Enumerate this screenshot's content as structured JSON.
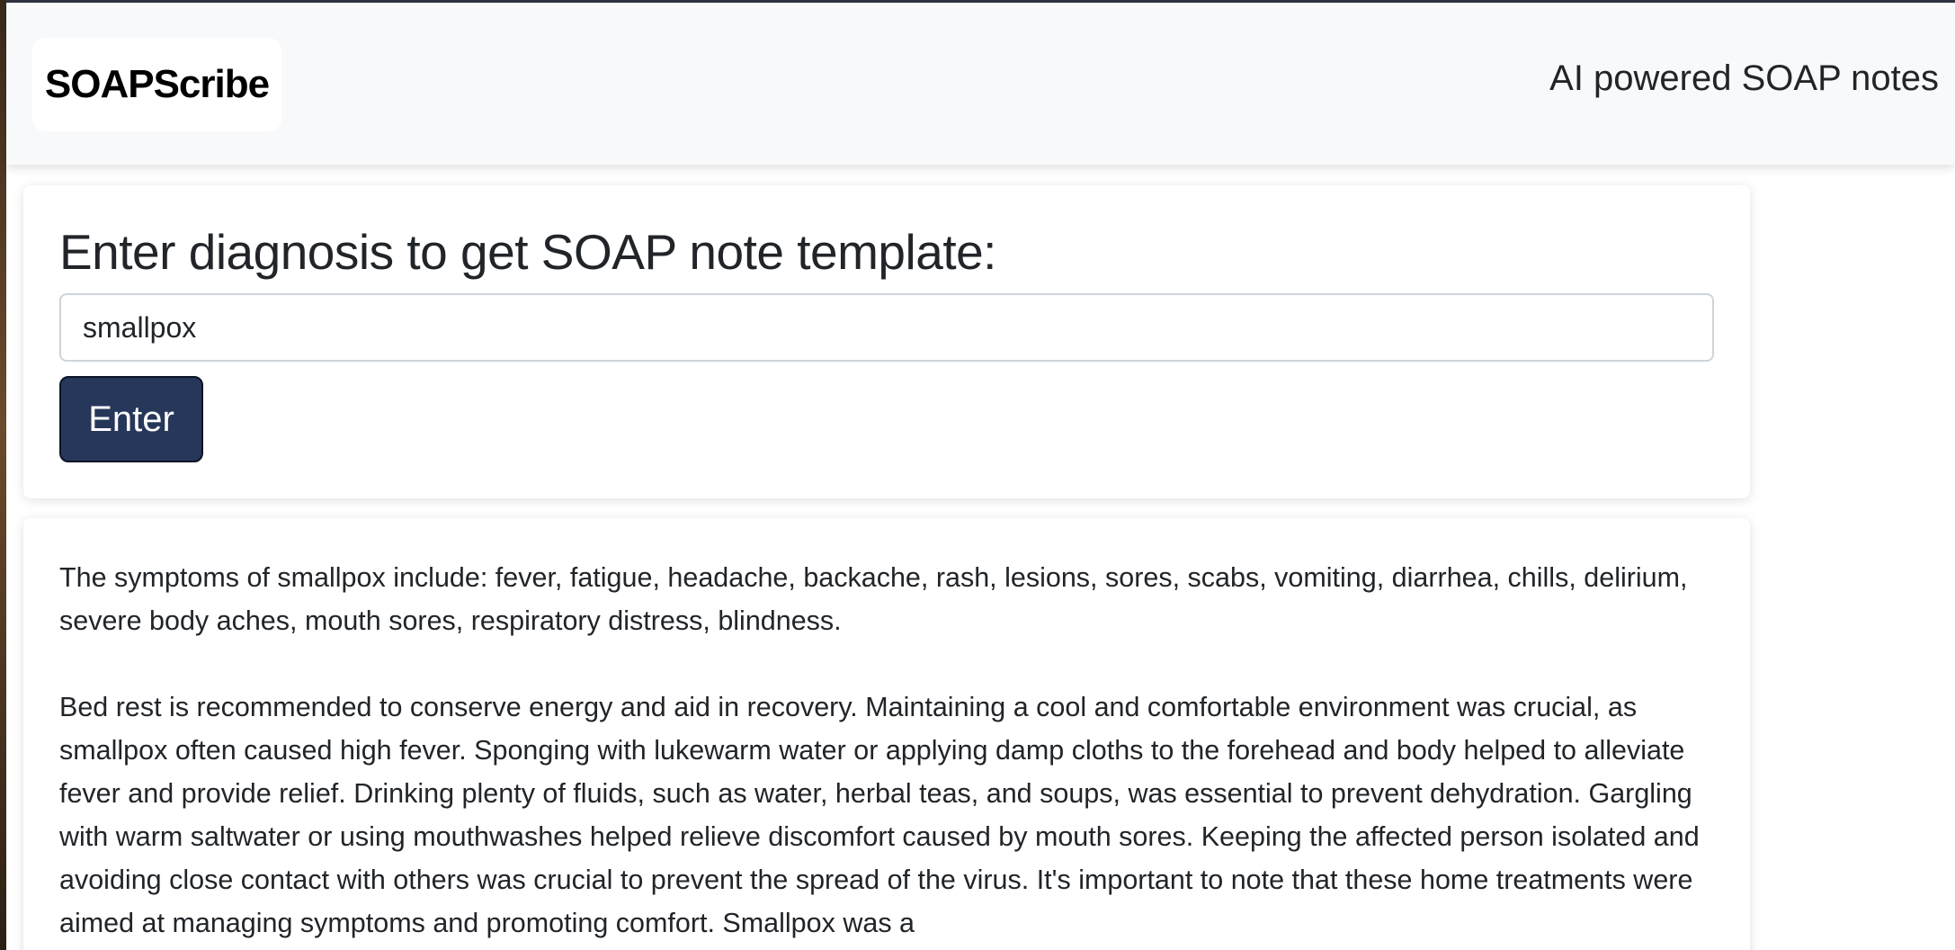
{
  "header": {
    "brand": "SOAPScribe",
    "tagline": "AI powered SOAP notes"
  },
  "form": {
    "title": "Enter diagnosis to get SOAP note template:",
    "input_value": "smallpox",
    "button_label": "Enter"
  },
  "result": {
    "paragraphs": [
      "The symptoms of smallpox include: fever, fatigue, headache, backache, rash, lesions, sores, scabs, vomiting, diarrhea, chills, delirium, severe body aches, mouth sores, respiratory distress, blindness.",
      "Bed rest is recommended to conserve energy and aid in recovery. Maintaining a cool and comfortable environment was crucial, as smallpox often caused high fever. Sponging with lukewarm water or applying damp cloths to the forehead and body helped to alleviate fever and provide relief. Drinking plenty of fluids, such as water, herbal teas, and soups, was essential to prevent dehydration. Gargling with warm saltwater or using mouthwashes helped relieve discomfort caused by mouth sores. Keeping the affected person isolated and avoiding close contact with others was crucial to prevent the spread of the virus. It's important to note that these home treatments were aimed at managing symptoms and promoting comfort. Smallpox was a"
    ]
  }
}
